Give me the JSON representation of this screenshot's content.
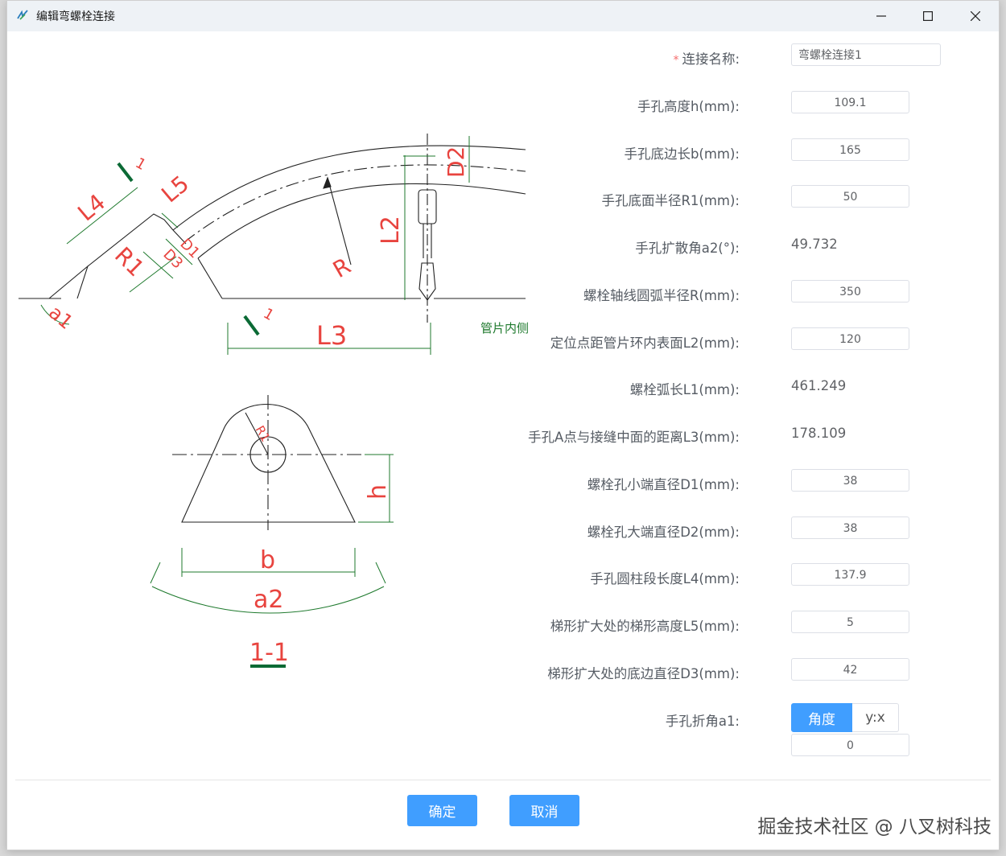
{
  "window": {
    "title": "编辑弯螺栓连接",
    "minimize_symbol": "—",
    "maximize_symbol": "□",
    "close_symbol": "✕"
  },
  "drawing": {
    "labels": {
      "a1": "a1",
      "l4": "L4",
      "l5": "L5",
      "r1": "R1",
      "d1": "D1",
      "d3": "D3",
      "r": "R",
      "l2": "L2",
      "d2": "D2",
      "l3": "L3",
      "section_mark_1": "1",
      "section_mark_2": "1",
      "inner_side": "管片内侧",
      "r1_small": "R1",
      "h": "h",
      "b": "b",
      "a2": "a2",
      "section": "1-1"
    },
    "colors": {
      "dim_line": "#1f7a2e",
      "dim_text": "#e8443f",
      "section_mark": "#0b6a35"
    }
  },
  "form": {
    "connection_name": {
      "label": "连接名称:",
      "required_mark": "*",
      "value": "弯螺栓连接1"
    },
    "hand_hole_height": {
      "label": "手孔高度h(mm):",
      "value": "109.1"
    },
    "hand_hole_base_b": {
      "label": "手孔底边长b(mm):",
      "value": "165"
    },
    "hand_hole_radius_r1": {
      "label": "手孔底面半径R1(mm):",
      "value": "50"
    },
    "hand_hole_angle_a2": {
      "label": "手孔扩散角a2(°):",
      "value": "49.732"
    },
    "bolt_arc_radius_r": {
      "label": "螺栓轴线圆弧半径R(mm):",
      "value": "350"
    },
    "locate_distance_l2": {
      "label": "定位点距管片环内表面L2(mm):",
      "value": "120"
    },
    "bolt_arc_length_l1": {
      "label": "螺栓弧长L1(mm):",
      "value": "461.249"
    },
    "hand_hole_distance_l3": {
      "label": "手孔A点与接缝中面的距离L3(mm):",
      "value": "178.109"
    },
    "bolt_hole_small_d1": {
      "label": "螺栓孔小端直径D1(mm):",
      "value": "38"
    },
    "bolt_hole_large_d2": {
      "label": "螺栓孔大端直径D2(mm):",
      "value": "38"
    },
    "cylinder_length_l4": {
      "label": "手孔圆柱段长度L4(mm):",
      "value": "137.9"
    },
    "trapezoid_height_l5": {
      "label": "梯形扩大处的梯形高度L5(mm):",
      "value": "5"
    },
    "trapezoid_base_d3": {
      "label": "梯形扩大处的底边直径D3(mm):",
      "value": "42"
    },
    "hand_hole_bend_a1": {
      "label": "手孔折角a1:",
      "mode_angle": "角度",
      "mode_ratio": "y:x",
      "selected_mode": "角度",
      "value": "0"
    }
  },
  "footer": {
    "confirm": "确定",
    "cancel": "取消"
  },
  "watermark": "掘金技术社区 @ 八叉树科技",
  "colors": {
    "primary": "#409eff",
    "label": "#555b63",
    "required": "#f56c6c"
  }
}
